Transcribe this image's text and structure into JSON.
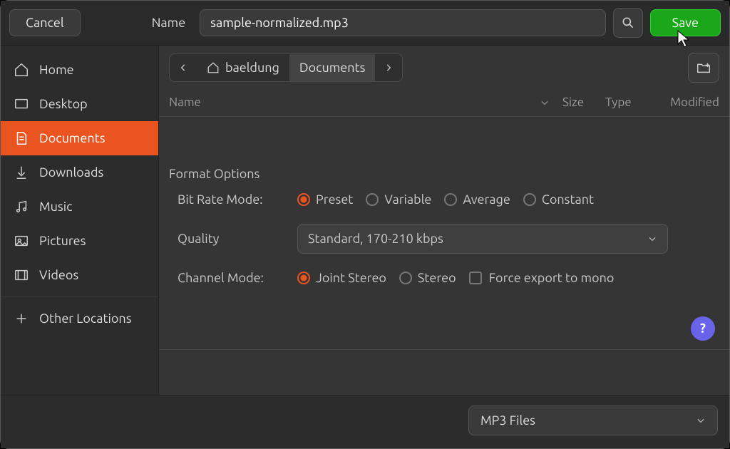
{
  "topbar": {
    "cancel": "Cancel",
    "name_label": "Name",
    "filename": "sample-normalized.mp3",
    "save": "Save"
  },
  "sidebar": {
    "items": [
      {
        "label": "Home",
        "icon": "home"
      },
      {
        "label": "Desktop",
        "icon": "desktop"
      },
      {
        "label": "Documents",
        "icon": "documents",
        "active": true
      },
      {
        "label": "Downloads",
        "icon": "downloads"
      },
      {
        "label": "Music",
        "icon": "music"
      },
      {
        "label": "Pictures",
        "icon": "pictures"
      },
      {
        "label": "Videos",
        "icon": "videos"
      }
    ],
    "other_locations": "Other Locations"
  },
  "breadcrumb": {
    "user": "baeldung",
    "current": "Documents"
  },
  "table": {
    "columns": {
      "name": "Name",
      "size": "Size",
      "type": "Type",
      "modified": "Modified"
    }
  },
  "format_options": {
    "title": "Format Options",
    "bitrate_label": "Bit Rate Mode:",
    "bitrate_modes": [
      "Preset",
      "Variable",
      "Average",
      "Constant"
    ],
    "bitrate_selected": "Preset",
    "quality_label": "Quality",
    "quality_value": "Standard, 170-210 kbps",
    "channel_label": "Channel Mode:",
    "channel_modes": [
      "Joint Stereo",
      "Stereo"
    ],
    "channel_selected": "Joint Stereo",
    "force_mono_label": "Force export to mono",
    "force_mono_checked": false
  },
  "footer": {
    "format": "MP3 Files"
  }
}
